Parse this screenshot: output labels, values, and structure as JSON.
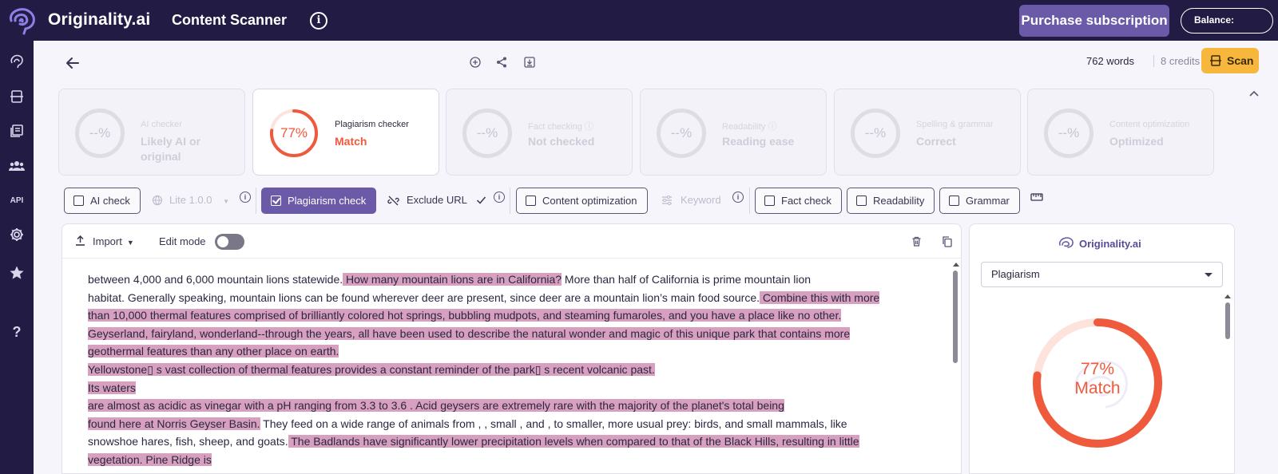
{
  "topbar": {
    "brand": "Originality.ai",
    "section_title": "Content Scanner",
    "info_icon": "info-icon",
    "purchase_label": "Purchase subscription",
    "balance_label": "Balance:"
  },
  "sidebar": {
    "items": [
      {
        "icon": "brain-icon"
      },
      {
        "icon": "document-scan-icon"
      },
      {
        "icon": "library-icon"
      },
      {
        "icon": "team-icon"
      },
      {
        "icon": "api-icon",
        "label": "API"
      },
      {
        "icon": "gear-icon"
      },
      {
        "icon": "star-icon"
      },
      {
        "icon": "help-icon",
        "label": "?"
      }
    ]
  },
  "header": {
    "word_count": "762 words",
    "credits": "8 credits",
    "scan_label": "Scan"
  },
  "cards": [
    {
      "ring": "--%",
      "label": "AI checker",
      "value": "Likely AI or original"
    },
    {
      "ring": "77%",
      "label": "Plagiarism checker",
      "value": "Match",
      "progress": 0.77
    },
    {
      "ring": "--%",
      "label": "Fact checking ⓘ",
      "value": "Not checked"
    },
    {
      "ring": "--%",
      "label": "Readability ⓘ",
      "value": "Reading ease"
    },
    {
      "ring": "--%",
      "label": "Spelling & grammar",
      "value": "Correct"
    },
    {
      "ring": "--%",
      "label": "Content optimization",
      "value": "Optimized"
    }
  ],
  "toolbar": {
    "ai_check": "AI check",
    "model": "Lite 1.0.0",
    "plagiarism_check": "Plagiarism check",
    "exclude_url": "Exclude URL",
    "content_optimization": "Content optimization",
    "keyword": "Keyword",
    "fact_check": "Fact check",
    "readability": "Readability",
    "grammar": "Grammar",
    "info": "i"
  },
  "editor": {
    "import_label": "Import",
    "edit_mode_label": "Edit mode",
    "edit_mode_on": false,
    "lines": [
      [
        {
          "t": "between 4,000 and 6,000 mountain lions statewide.",
          "h": false
        },
        {
          "t": " How many mountain lions are in California?",
          "h": true
        },
        {
          "t": "  More than half of California is prime mountain lion",
          "h": false
        }
      ],
      [
        {
          "t": "habitat.  Generally speaking, mountain lions can be found wherever deer are present, since deer are a mountain lion’s main food source.",
          "h": false
        },
        {
          "t": "  Combine this with more",
          "h": true
        }
      ],
      [
        {
          "t": "than 10,000 thermal features comprised of brilliantly colored hot springs, bubbling mudpots, and steaming fumaroles, and you have a place like no other. ",
          "h": true
        }
      ],
      [
        {
          "t": "Geyserland, fairyland, wonderland--through the years, all have been used to describe the natural wonder and magic of this unique park that contains more",
          "h": true
        }
      ],
      [
        {
          "t": "geothermal features than any other place on earth.",
          "h": true
        }
      ],
      [
        {
          "t": "Yellowstone▯ s vast collection of thermal features provides a constant reminder of the park▯ s recent volcanic past.",
          "h": true
        }
      ],
      [
        {
          "t": "Its waters",
          "h": true
        }
      ],
      [
        {
          "t": "are almost as acidic as vinegar with a pH ranging from 3.3 to 3.6 .  Acid geysers are extremely rare with the majority of the planet's total being",
          "h": true
        }
      ],
      [
        {
          "t": "found here at Norris Geyser Basin.",
          "h": true
        },
        {
          "t": "  They feed on a wide range of animals from , , small , and , to smaller, more usual prey: birds, and small mammals, like",
          "h": false
        }
      ],
      [
        {
          "t": "snowshoe hares, fish, sheep, and goats.",
          "h": false
        },
        {
          "t": "  The Badlands have significantly lower precipitation levels when compared to that of the Black Hills, resulting in little",
          "h": true
        }
      ],
      [
        {
          "t": "vegetation.  Pine Ridge is",
          "h": true
        }
      ]
    ]
  },
  "right_panel": {
    "brand": "Originality.ai",
    "select_value": "Plagiarism",
    "percent": "77%",
    "match_label": "Match",
    "progress": 0.77
  },
  "colors": {
    "nav_bg": "#221c45",
    "accent_purple": "#6a5aa8",
    "scan_yellow": "#f6b73c",
    "match_orange": "#ef5a3c",
    "highlight": "#d8a0bf"
  }
}
